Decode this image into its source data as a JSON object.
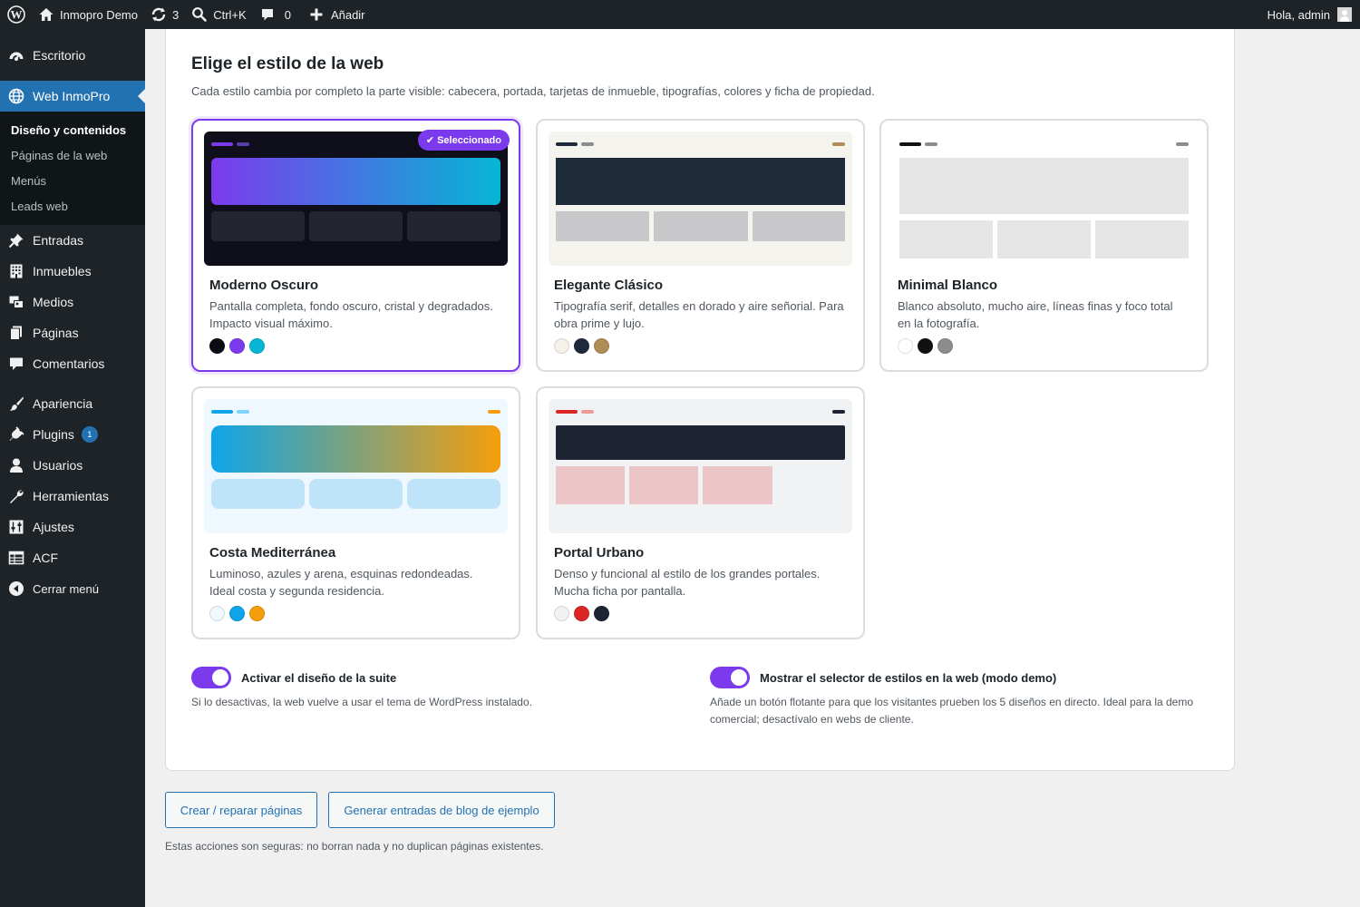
{
  "admin_bar": {
    "site_name": "Inmopro Demo",
    "updates_count": "3",
    "search_shortcut": "Ctrl+K",
    "comments_count": "0",
    "add_new": "Añadir",
    "greeting": "Hola, admin"
  },
  "sidebar": {
    "items": [
      {
        "label": "Escritorio",
        "icon": "dashboard-icon"
      },
      {
        "label": "Web InmoPro",
        "icon": "globe-icon"
      },
      {
        "label": "Entradas",
        "icon": "pushpin-icon"
      },
      {
        "label": "Inmuebles",
        "icon": "building-icon"
      },
      {
        "label": "Medios",
        "icon": "media-icon"
      },
      {
        "label": "Páginas",
        "icon": "pages-icon"
      },
      {
        "label": "Comentarios",
        "icon": "comment-icon"
      },
      {
        "label": "Apariencia",
        "icon": "brush-icon"
      },
      {
        "label": "Plugins",
        "icon": "plug-icon",
        "badge": "1"
      },
      {
        "label": "Usuarios",
        "icon": "user-icon"
      },
      {
        "label": "Herramientas",
        "icon": "wrench-icon"
      },
      {
        "label": "Ajustes",
        "icon": "settings-icon"
      },
      {
        "label": "ACF",
        "icon": "table-icon"
      },
      {
        "label": "Cerrar menú",
        "icon": "collapse-icon"
      }
    ],
    "submenu": [
      "Diseño y contenidos",
      "Páginas de la web",
      "Menús",
      "Leads web"
    ]
  },
  "panel": {
    "title": "Elige el estilo de la web",
    "description": "Cada estilo cambia por completo la parte visible: cabecera, portada, tarjetas de inmueble, tipografías, colores y ficha de propiedad.",
    "selected_label": "✔ Seleccionado",
    "styles": [
      {
        "name": "Moderno Oscuro",
        "desc": "Pantalla completa, fondo oscuro, cristal y degradados. Impacto visual máximo.",
        "swatches": [
          "#0b0b16",
          "#7c3aed",
          "#06b6d4"
        ],
        "selected": true
      },
      {
        "name": "Elegante Clásico",
        "desc": "Tipografía serif, detalles en dorado y aire señorial. Para obra prime y lujo.",
        "swatches": [
          "#f4f1ea",
          "#1e293b",
          "#b08d57"
        ],
        "selected": false
      },
      {
        "name": "Minimal Blanco",
        "desc": "Blanco absoluto, mucho aire, líneas finas y foco total en la fotografía.",
        "swatches": [
          "#ffffff",
          "#111111",
          "#8c8c8c"
        ],
        "selected": false
      },
      {
        "name": "Costa Mediterránea",
        "desc": "Luminoso, azules y arena, esquinas redondeadas. Ideal costa y segunda residencia.",
        "swatches": [
          "#f0f8ff",
          "#0ea5e9",
          "#f59e0b"
        ],
        "selected": false
      },
      {
        "name": "Portal Urbano",
        "desc": "Denso y funcional al estilo de los grandes portales. Mucha ficha por pantalla.",
        "swatches": [
          "#f1f2f4",
          "#dc2626",
          "#1e2433"
        ],
        "selected": false
      }
    ],
    "toggles": [
      {
        "label": "Activar el diseño de la suite",
        "desc": "Si lo desactivas, la web vuelve a usar el tema de WordPress instalado.",
        "on": true
      },
      {
        "label": "Mostrar el selector de estilos en la web (modo demo)",
        "desc": "Añade un botón flotante para que los visitantes prueben los 5 diseños en directo. Ideal para la demo comercial; desactívalo en webs de cliente.",
        "on": true
      }
    ]
  },
  "actions": {
    "create_pages": "Crear / reparar páginas",
    "generate_posts": "Generar entradas de blog de ejemplo",
    "note": "Estas acciones son seguras: no borran nada y no duplican páginas existentes."
  },
  "colors": {
    "accent": "#7c3aed",
    "wp_blue": "#2271b1",
    "admin_dark": "#1d2327"
  }
}
